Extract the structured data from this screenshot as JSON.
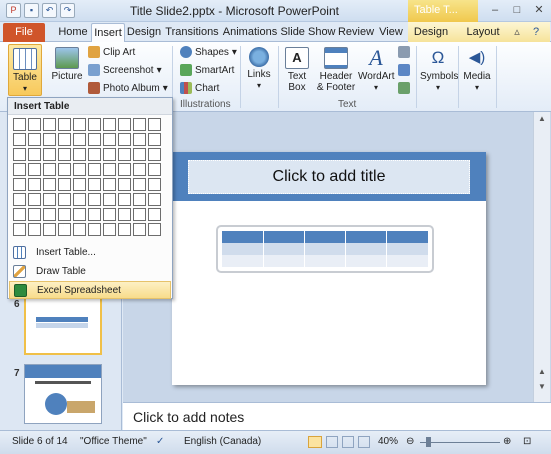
{
  "window": {
    "title": "Title Slide2.pptx - Microsoft PowerPoint",
    "context_tab_group": "Table T..."
  },
  "tabs": [
    "File",
    "Home",
    "Insert",
    "Design",
    "Transitions",
    "Animations",
    "Slide Show",
    "Review",
    "View",
    "Design",
    "Layout"
  ],
  "active_tab": "Insert",
  "ribbon": {
    "table": "Table",
    "picture": "Picture",
    "clip_art": "Clip Art",
    "screenshot": "Screenshot",
    "photo_album": "Photo Album",
    "shapes": "Shapes",
    "smartart": "SmartArt",
    "chart": "Chart",
    "links": "Links",
    "text_box": "Text Box",
    "header_footer": "Header & Footer",
    "wordart": "WordArt",
    "symbols": "Symbols",
    "media": "Media",
    "group_illustrations": "Illustrations",
    "group_text": "Text"
  },
  "table_menu": {
    "header": "Insert Table",
    "grid_cols": 10,
    "grid_rows": 8,
    "items": [
      "Insert Table...",
      "Draw Table",
      "Excel Spreadsheet"
    ]
  },
  "slides_panel": {
    "visible_numbers": [
      "6",
      "7"
    ]
  },
  "slide": {
    "title_placeholder": "Click to add title"
  },
  "notes": {
    "placeholder": "Click to add notes"
  },
  "status": {
    "slide_info": "Slide 6 of 14",
    "theme": "\"Office Theme\"",
    "language": "English (Canada)",
    "zoom": "40%"
  },
  "colors": {
    "accent": "#4f81bd",
    "file_tab": "#d0552a",
    "context_tab": "#f0c84d"
  }
}
